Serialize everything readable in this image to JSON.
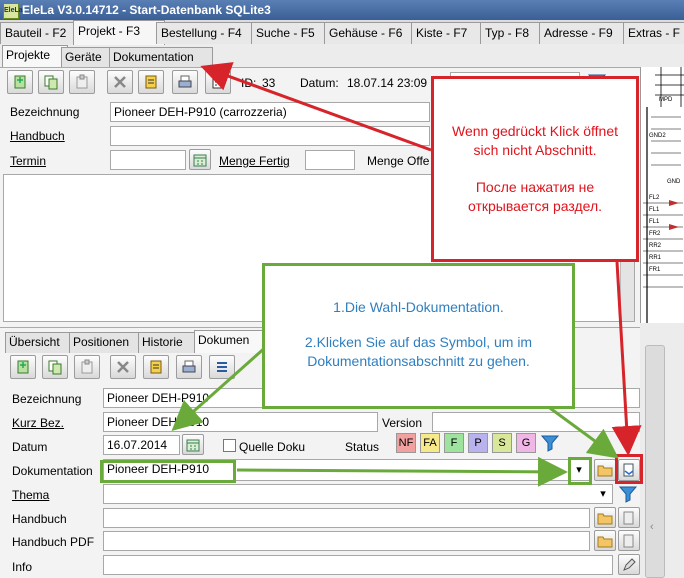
{
  "window": {
    "title": "EleLa V3.0.14712 - Start-Datenbank SQLite3",
    "icon_text": "EleLa"
  },
  "main_tabs": [
    {
      "label": "Bauteil - F2"
    },
    {
      "label": "Projekt - F3"
    },
    {
      "label": "Bestellung - F4"
    },
    {
      "label": "Suche - F5"
    },
    {
      "label": "Gehäuse - F6"
    },
    {
      "label": "Kiste - F7"
    },
    {
      "label": "Typ - F8"
    },
    {
      "label": "Adresse - F9"
    },
    {
      "label": "Extras - F"
    }
  ],
  "sub_tabs": [
    {
      "label": "Projekte"
    },
    {
      "label": "Geräte"
    },
    {
      "label": "Dokumentation"
    }
  ],
  "project": {
    "id_label": "ID:",
    "id_value": "33",
    "datum_label": "Datum:",
    "datum_value": "18.07.14 23:09",
    "bezeichnung_label": "Bezeichnung",
    "bezeichnung_value": "Pioneer DEH-P910 (carrozzeria)",
    "handbuch_label": "Handbuch",
    "termin_label": "Termin",
    "menge_fertig_label": "Menge Fertig",
    "menge_offen_label": "Menge Offe"
  },
  "lower_tabs": [
    {
      "label": "Übersicht"
    },
    {
      "label": "Positionen"
    },
    {
      "label": "Historie"
    },
    {
      "label": "Dokumen"
    }
  ],
  "doc": {
    "bezeichnung_label": "Bezeichnung",
    "bezeichnung_value": "Pioneer DEH-P910",
    "kurz_label": "Kurz Bez.",
    "kurz_value": "Pioneer DEH-P910",
    "version_label": "Version",
    "datum_label": "Datum",
    "datum_value": "16.07.2014",
    "quelle_label": "Quelle Doku",
    "status_label": "Status",
    "status_chips": [
      "NF",
      "FA",
      "F",
      "P",
      "S",
      "G"
    ],
    "dokumentation_label": "Dokumentation",
    "dokumentation_value": "Pioneer DEH-P910",
    "thema_label": "Thema",
    "handbuch_label": "Handbuch",
    "handbuch_pdf_label": "Handbuch PDF",
    "info_label": "Info"
  },
  "annotations": {
    "red_de": "Wenn gedrückt Klick öffnet sich nicht Abschnitt.",
    "red_ru": "После нажатия не открывается раздел.",
    "green_1": "1.Die Wahl-Dokumentation.",
    "green_2": "2.Klicken Sie auf das Symbol, um im Dokumentationsabschnitt zu gehen."
  },
  "schematic_labels": [
    "GND2",
    "FL2",
    "FL1",
    "FL1",
    "FR2",
    "RR2",
    "RR1",
    "FR1",
    "GND",
    "MPD"
  ],
  "colors": {
    "red": "#d6242a",
    "green": "#6aaa3a",
    "annotation_text": "#2f7fc0",
    "chip_nf": "#f2a0a0",
    "chip_fa": "#f6e98a",
    "chip_f": "#9de39d",
    "chip_p": "#b8b2ee",
    "chip_s": "#d8e89a",
    "chip_g": "#f0b6e6"
  }
}
